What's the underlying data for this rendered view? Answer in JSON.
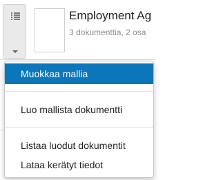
{
  "toolbar": {
    "icons": {
      "list": "list-icon",
      "caret": "caret-down-icon"
    }
  },
  "card": {
    "title": "Employment Ag",
    "subtitle": "3 dokumenttia, 2 osa"
  },
  "menu": {
    "items": [
      {
        "label": "Muokkaa mallia",
        "active": true
      },
      {
        "label": "Luo mallista dokumentti",
        "active": false
      },
      {
        "label": "Listaa luodut dokumentit",
        "active": false
      },
      {
        "label": "Lataa kerätyt tiedot",
        "active": false
      }
    ]
  },
  "colors": {
    "highlight": "#0b76ba",
    "highlight_text": "#ffffff",
    "text": "#222222",
    "muted": "#8a8a8a"
  }
}
